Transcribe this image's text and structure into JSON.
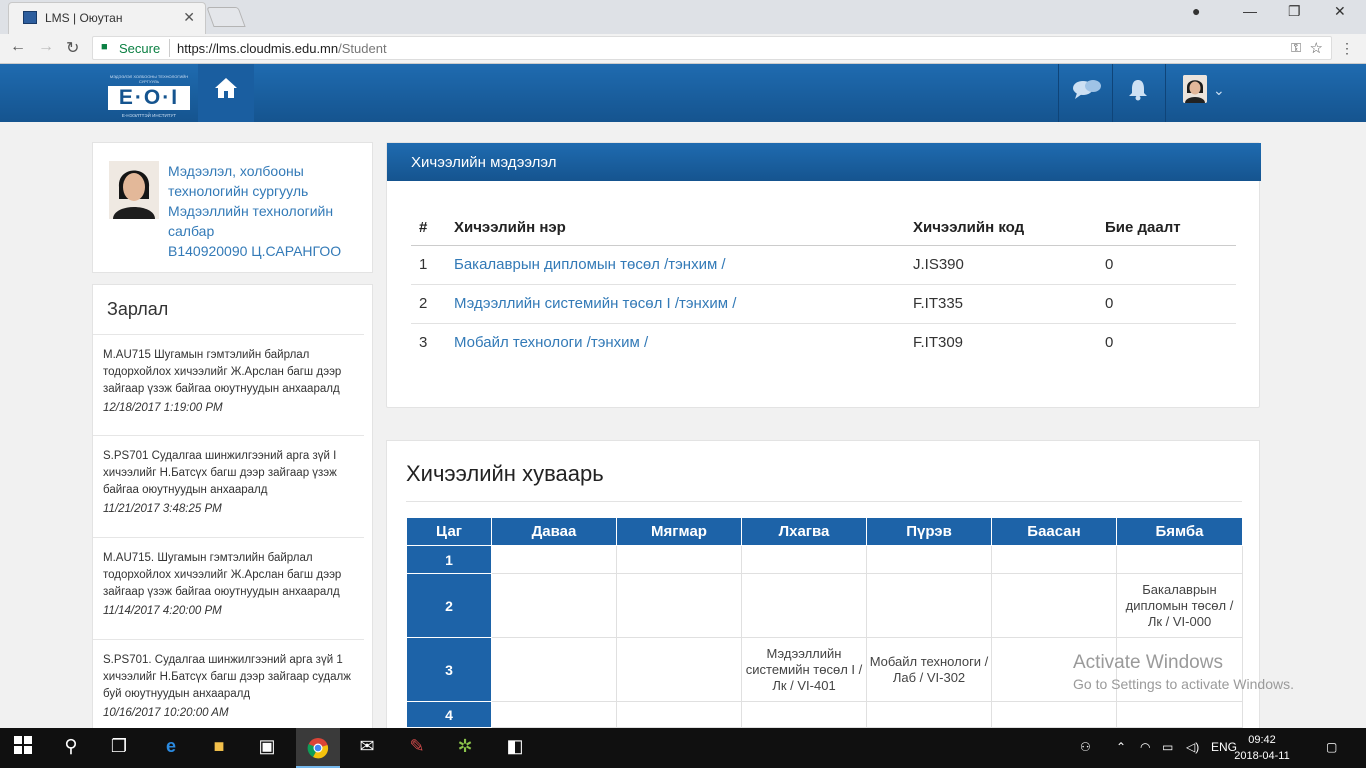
{
  "browser": {
    "tab_title": "LMS | Оюутан",
    "secure_label": "Secure",
    "url_host": "https://lms.cloudmis.edu.mn",
    "url_path": "/Student"
  },
  "header": {
    "logo_text": "E·O·I",
    "logo_top": "МЭДЭЭЛЭЛ ХОЛБООНЫ ТЕХНОЛОГИЙН СУРГУУЛЬ",
    "logo_bottom": "Е-НЭЭЛТТЭЙ ИНСТИТУТ"
  },
  "profile": {
    "line1": "Мэдээлэл, холбооны",
    "line2": "технологийн сургууль",
    "line3": "Мэдээллийн технологийн",
    "line4": "салбар",
    "line5": "B140920090 Ц.САРАНГОО"
  },
  "announcements": {
    "title": "Зарлал",
    "items": [
      {
        "text": "M.AU715 Шугамын гэмтэлийн байрлал тодорхойлох хичээлийг Ж.Арслан багш дээр зайгаар үзэж байгаа оюутнуудын анхааралд",
        "date": "12/18/2017 1:19:00 PM"
      },
      {
        "text": "S.PS701 Судалгаа шинжилгээний арга зүй I хичээлийг Н.Батсүх багш дээр зайгаар үзэж байгаа оюутнуудын анхааралд",
        "date": "11/21/2017 3:48:25 PM"
      },
      {
        "text": "M.AU715. Шугамын гэмтэлийн байрлал тодорхойлох хичээлийг Ж.Арслан багш дээр зайгаар үзэж байгаа оюутнуудын анхааралд",
        "date": "11/14/2017 4:20:00 PM"
      },
      {
        "text": "S.PS701. Судалгаа шинжилгээний арга зүй 1 хичээлийг Н.Батсүх багш дээр зайгаар судалж буй оюутнуудын анхааралд",
        "date": "10/16/2017 10:20:00 AM"
      }
    ]
  },
  "course_info": {
    "title": "Хичээлийн мэдээлэл",
    "columns": [
      "#",
      "Хичээлийн нэр",
      "Хичээлийн код",
      "Бие даалт"
    ],
    "rows": [
      {
        "num": "1",
        "name": "Бакалаврын дипломын төсөл /тэнхим /",
        "code": "J.IS390",
        "self": "0"
      },
      {
        "num": "2",
        "name": "Мэдээллийн системийн төсөл I /тэнхим /",
        "code": "F.IT335",
        "self": "0"
      },
      {
        "num": "3",
        "name": "Мобайл технологи /тэнхим /",
        "code": "F.IT309",
        "self": "0"
      }
    ]
  },
  "schedule": {
    "title": "Хичээлийн хуваарь",
    "columns": [
      "Цаг",
      "Даваа",
      "Мягмар",
      "Лхагва",
      "Пүрэв",
      "Баасан",
      "Бямба"
    ],
    "rows": [
      {
        "hour": "1",
        "cells": [
          "",
          "",
          "",
          "",
          "",
          ""
        ]
      },
      {
        "hour": "2",
        "cells": [
          "",
          "",
          "",
          "",
          "",
          "Бакалаврын дипломын төсөл / Лк / VI-000"
        ]
      },
      {
        "hour": "3",
        "cells": [
          "",
          "",
          "Мэдээллийн системийн төсөл I / Лк / VI-401",
          "Мобайл технологи / Лаб / VI-302",
          "",
          ""
        ]
      },
      {
        "hour": "4",
        "cells": [
          "",
          "",
          "",
          "",
          "",
          ""
        ]
      }
    ]
  },
  "watermark": {
    "line1": "Activate Windows",
    "line2": "Go to Settings to activate Windows."
  },
  "taskbar": {
    "lang": "ENG",
    "time": "09:42",
    "date": "2018-04-11"
  }
}
